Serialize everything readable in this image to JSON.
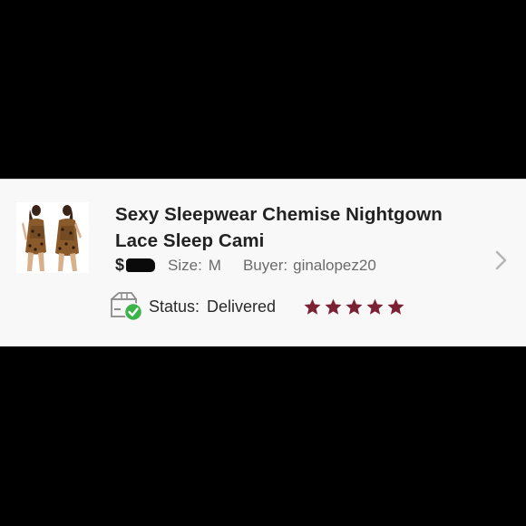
{
  "listing": {
    "title": "Sexy Sleepwear Chemise Nightgown Lace Sleep Cami",
    "price_symbol": "$",
    "size_label": "Size:",
    "size_value": "M",
    "buyer_label": "Buyer:",
    "buyer_value": "ginalopez20",
    "status_label": "Status:",
    "status_value": "Delivered",
    "rating": 5,
    "rating_max": 5
  },
  "colors": {
    "star": "#7a2233",
    "check": "#3cb34a",
    "background": "#000000",
    "card": "#f9f8f9"
  },
  "icons": {
    "status": "package-delivered-icon",
    "navigate": "chevron-right-icon",
    "rating": "star-icon"
  }
}
